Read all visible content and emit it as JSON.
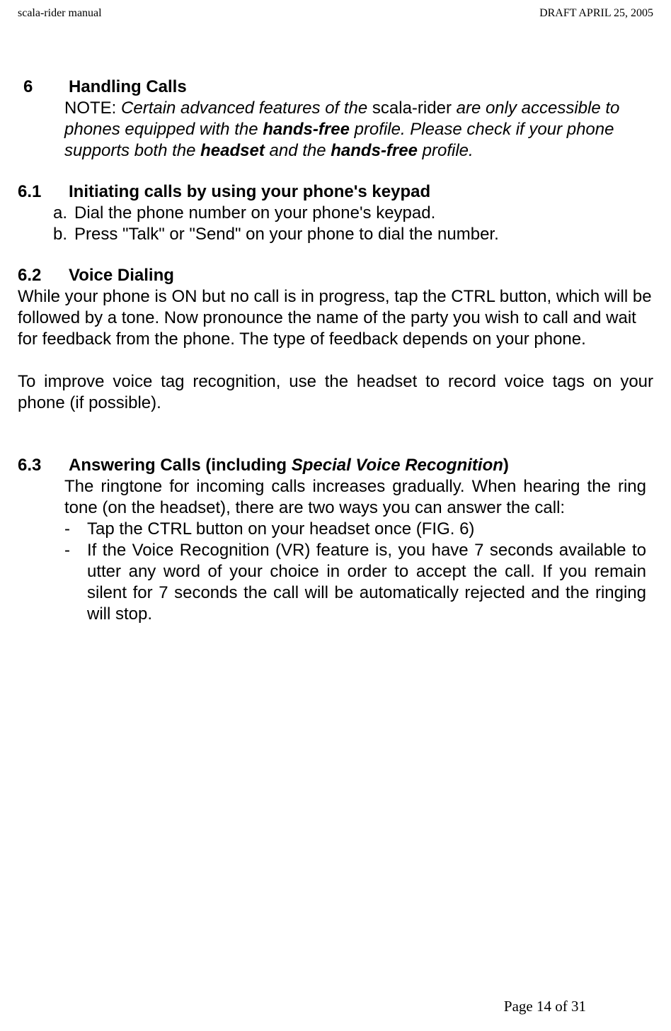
{
  "header": {
    "left": "scala-rider manual",
    "right": "DRAFT  APRIL 25, 2005"
  },
  "s6": {
    "num": "6",
    "title": "Handling Calls",
    "note_label": "NOTE: ",
    "note_p1": "Certain advanced features of the ",
    "note_p2": "scala-rider",
    "note_p3": " are only accessible to phones equipped with the ",
    "note_p4": "hands-free",
    "note_p5": " profile. Please check if your phone supports both the ",
    "note_p6": "headset",
    "note_p7": " and the ",
    "note_p8": "hands-free",
    "note_p9": " profile."
  },
  "s61": {
    "num": "6.1",
    "title": "Initiating calls by using your phone's keypad",
    "a_marker": "a.",
    "a_text": "Dial the phone number on your phone's keypad.",
    "b_marker": "b.",
    "b_text": "Press \"Talk\" or \"Send\" on your phone to dial the number."
  },
  "s62": {
    "num": "6.2",
    "title": "Voice Dialing",
    "p1": "While your phone is ON but no call is in progress, tap the CTRL button, which will be followed by a tone. Now pronounce the name of the party you wish to call and wait for feedback from the phone. The type of feedback depends on your phone.",
    "p2": "To improve voice tag recognition, use the headset to record voice tags on your phone (if possible)."
  },
  "s63": {
    "num": "6.3",
    "title_a": "Answering Calls (including ",
    "title_b": "Special Voice Recognition",
    "title_c": ")",
    "p1": "The ringtone for incoming calls increases gradually. When hearing the ring tone (on the headset), there are two ways you can answer the call:",
    "d1_marker": "-",
    "d1_text": "Tap the CTRL button on your headset once (FIG. 6)",
    "d2_marker": "-",
    "d2_text": "If the Voice Recognition (VR) feature is, you have 7 seconds available to utter any word of your choice in order to accept the call. If you remain silent for 7 seconds the call will be automatically rejected and the ringing will stop."
  },
  "footer": {
    "text": "Page 14 of 31"
  }
}
